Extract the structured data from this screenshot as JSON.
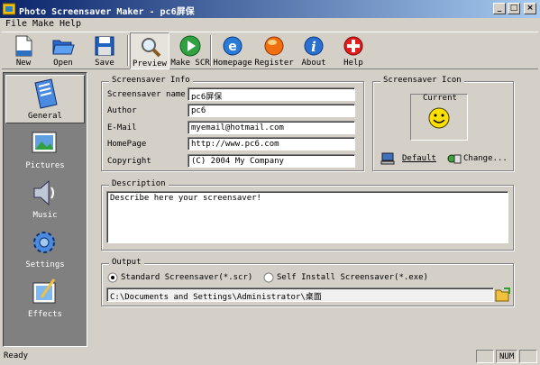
{
  "window": {
    "title": "Photo Screensaver Maker - pc6屏保",
    "minimize": "_",
    "maximize": "□",
    "close": "×"
  },
  "menu": [
    "File",
    "Make",
    "Help"
  ],
  "toolbar": {
    "new": "New",
    "open": "Open",
    "save": "Save",
    "preview": "Preview",
    "make_scr": "Make SCR",
    "homepage": "Homepage",
    "register": "Register",
    "about": "About",
    "help": "Help"
  },
  "sidebar": [
    "General",
    "Pictures",
    "Music",
    "Settings",
    "Effects"
  ],
  "info": {
    "legend": "Screensaver Info",
    "labels": {
      "name": "Screensaver name",
      "author": "Author",
      "email": "E-Mail",
      "homepage": "HomePage",
      "copyright": "Copyright"
    },
    "values": {
      "name": "pc6屏保",
      "author": "pc6",
      "email": "myemail@hotmail.com",
      "homepage": "http://www.pc6.com",
      "copyright": "(C) 2004 My Company"
    }
  },
  "icon_panel": {
    "legend": "Screensaver Icon",
    "current_label": "Current",
    "default_label": "Default",
    "change_label": "Change..."
  },
  "description": {
    "legend": "Description",
    "text": "Describe here your screensaver!"
  },
  "output": {
    "legend": "Output",
    "option_standard": "Standard Screensaver(*.scr)",
    "option_self_install": "Self Install Screensaver(*.exe)",
    "selected": "standard",
    "path": "C:\\Documents and Settings\\Administrator\\桌面"
  },
  "status": {
    "text": "Ready",
    "num": "NUM"
  },
  "colors": {
    "titlebar_start": "#0a246a",
    "titlebar_end": "#a6caf0",
    "face": "#d4d0c8",
    "sidebar": "#808080"
  }
}
